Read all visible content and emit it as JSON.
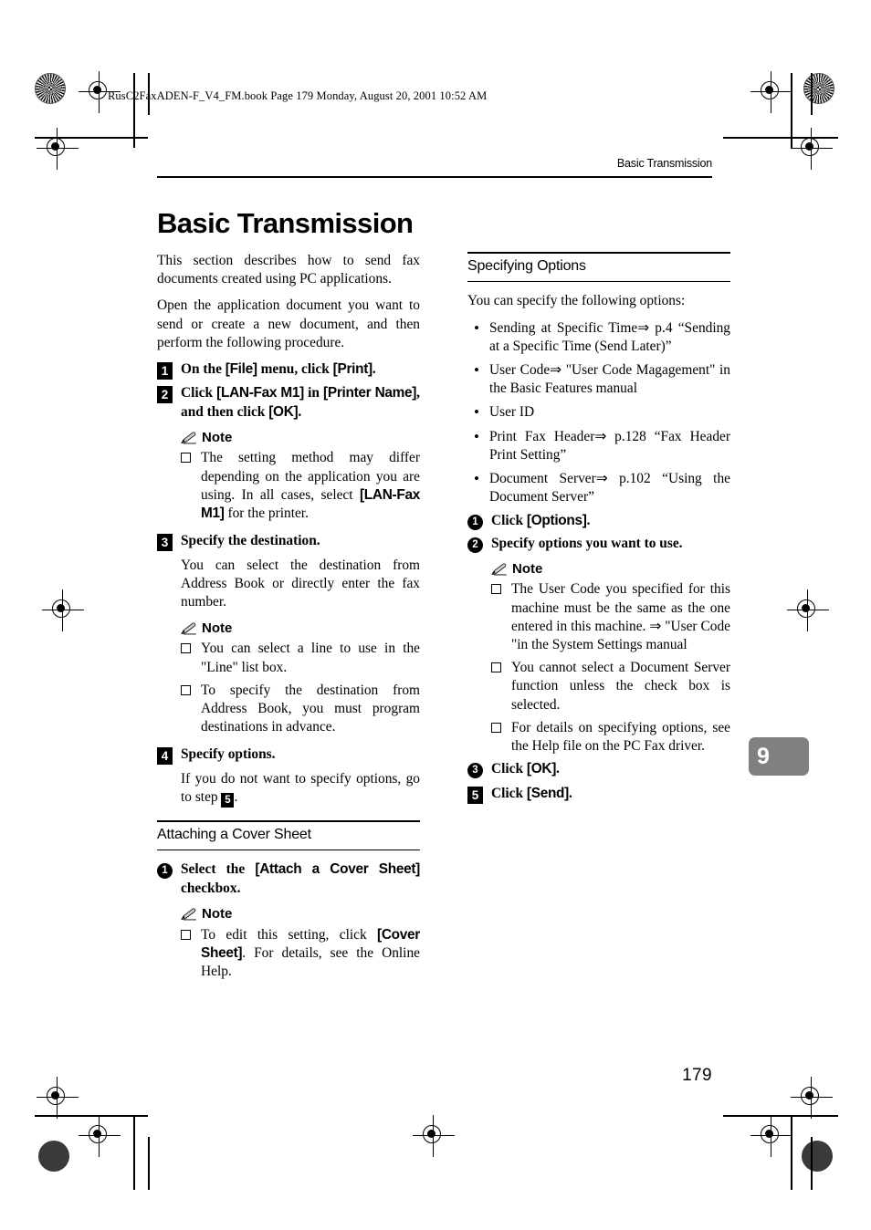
{
  "book_header": "RusC2FaxADEN-F_V4_FM.book  Page 179  Monday, August 20, 2001  10:52 AM",
  "running_head": "Basic Transmission",
  "chapter_title": "Basic Transmission",
  "chapter_tab": "9",
  "page_number": "179",
  "colors": {
    "text": "#000000",
    "tab_background": "#808080",
    "tab_text": "#ffffff",
    "rule": "#000000"
  },
  "left_column": {
    "intro_paragraph_1": "This section describes how to send fax documents created using PC applications.",
    "intro_paragraph_2": "Open the application document you want to send or create a new document, and then perform the following procedure.",
    "step1": {
      "marker": "1",
      "text_a": "On the ",
      "key_a": "[File]",
      "text_b": " menu, click ",
      "key_b": "[Print]",
      "text_c": "."
    },
    "step2": {
      "marker": "2",
      "text_a": "Click ",
      "key_a": "[LAN-Fax M1]",
      "text_b": " in ",
      "key_b": "[Printer Name]",
      "text_c": ", and then click ",
      "key_c": "[OK]",
      "text_d": "."
    },
    "note1_label": "Note",
    "note1_item": {
      "text_a": "The setting method may differ depending on the application you are using. In all cases, select ",
      "key_a": "[LAN-Fax M1]",
      "text_b": " for the printer."
    },
    "step3": {
      "marker": "3",
      "text": "Specify the destination."
    },
    "step3_body": "You can select the destination from Address Book or directly enter the fax number.",
    "note2_label": "Note",
    "note2_items": [
      "You can select a line to use in the \"Line\" list box.",
      "To specify the destination from Address Book, you must program destinations in advance."
    ],
    "step4": {
      "marker": "4",
      "text": "Specify options."
    },
    "step4_body_a": "If you do not want to specify options, go to step ",
    "step4_body_marker": "5",
    "step4_body_b": ".",
    "subsection_title": "Attaching a Cover Sheet",
    "sub_step1": {
      "marker": "1",
      "text_a": "Select the ",
      "key_a": "[Attach a Cover Sheet]",
      "text_b": " checkbox."
    },
    "note3_label": "Note",
    "note3_item": {
      "text_a": "To edit this setting, click ",
      "key_a": "[Cover Sheet]",
      "text_b": ". For details, see the Online Help."
    }
  },
  "right_column": {
    "section_title": "Specifying Options",
    "intro": "You can specify the following options:",
    "bullets": [
      "Sending at Specific Time⇒ p.4 “Sending at a Specific Time (Send Later)”",
      "User Code⇒ \"User Code Magagement\" in the Basic Features manual",
      "User ID",
      "Print Fax Header⇒ p.128 “Fax Header Print Setting”",
      "Document Server⇒ p.102 “Using the Document Server”"
    ],
    "sub_step1": {
      "marker": "1",
      "text_a": "Click ",
      "key_a": "[Options]",
      "text_b": "."
    },
    "sub_step2": {
      "marker": "2",
      "text": "Specify options you want to use."
    },
    "note_label": "Note",
    "note_items": [
      "The User Code you specified for this machine must be the same as the one entered in this machine. ⇒ \"User Code \"in the System Settings manual",
      "You cannot select a Document Server function unless the check box is selected.",
      "For details on specifying options, see the Help file on the PC Fax driver."
    ],
    "sub_step3": {
      "marker": "3",
      "text_a": "Click ",
      "key_a": "[OK]",
      "text_b": "."
    },
    "step5": {
      "marker": "5",
      "text_a": "Click ",
      "key_a": "[Send]",
      "text_b": "."
    }
  }
}
